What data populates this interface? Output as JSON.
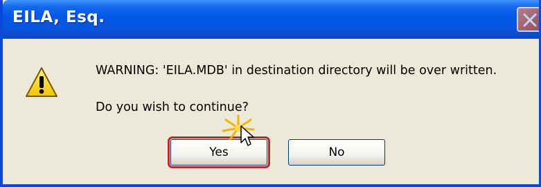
{
  "window": {
    "title": "EILA, Esq."
  },
  "dialog": {
    "message": "WARNING: 'EILA.MDB' in destination directory will be over written.",
    "question": "Do you wish to continue?",
    "buttons": {
      "yes": "Yes",
      "no": "No"
    }
  },
  "icons": {
    "dialog": "warning-icon",
    "close": "close-icon",
    "cursor": "mouse-pointer-icon"
  },
  "colors": {
    "titlebar": "#0058e6",
    "highlight": "#c1272d",
    "dialog_bg": "#ece9d8"
  }
}
